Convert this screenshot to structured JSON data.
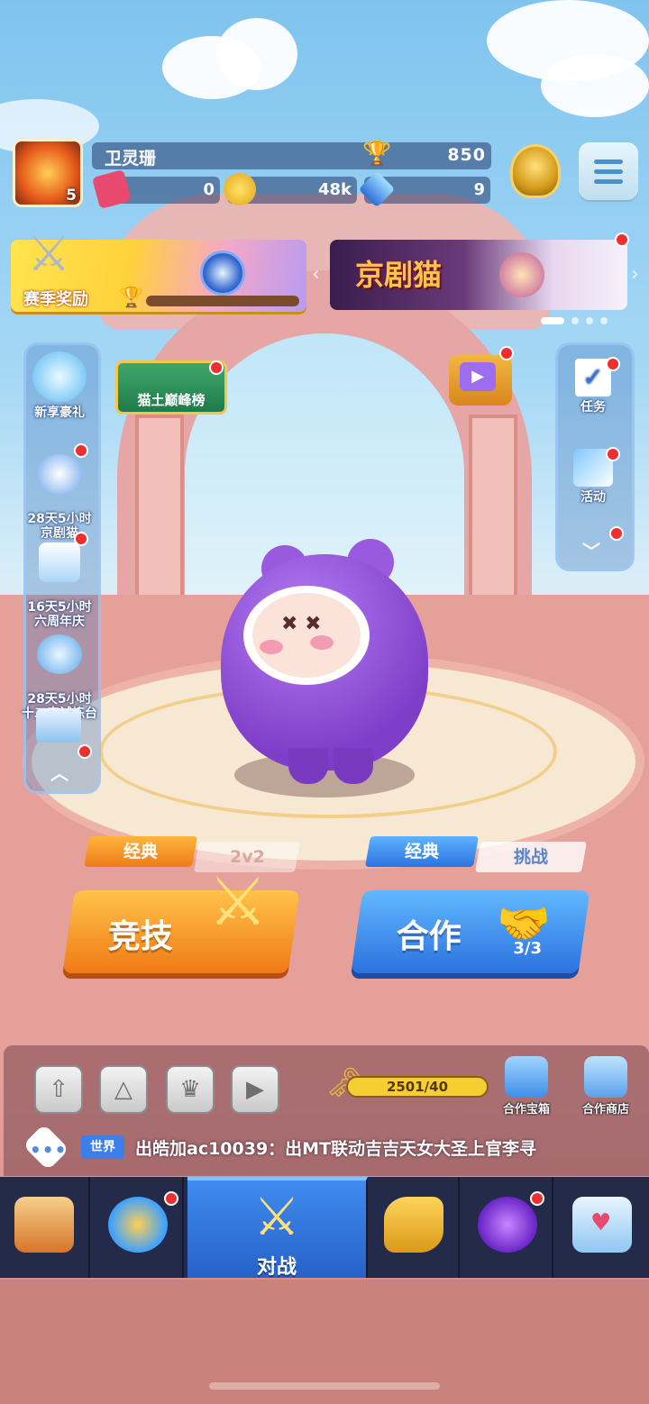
{
  "player": {
    "name": "卫灵珊",
    "level": "5",
    "trophies": "850",
    "currency_tickets": "0",
    "currency_coins": "48k",
    "currency_gems": "9"
  },
  "banners": {
    "season_reward": "赛季奖励",
    "event_title": "京剧猫"
  },
  "left_sidebar": [
    {
      "label": "新享豪礼",
      "icon": "lotus-gift-icon"
    },
    {
      "label": "28天5小时\n京剧猫",
      "icon": "cat-mask-icon"
    },
    {
      "label": "16天5小时\n六周年庆",
      "icon": "birthday-cake-icon"
    },
    {
      "label": "28天5小时\n十二宗试炼台",
      "icon": "star-shield-icon"
    }
  ],
  "leaderboard_label": "猫土巅峰榜",
  "right_sidebar": [
    {
      "label": "任务",
      "icon": "checklist-icon"
    },
    {
      "label": "活动",
      "icon": "party-popper-icon"
    }
  ],
  "modes": {
    "arena_tag": "经典",
    "arena_count": "2v2",
    "arena_label": "竞技",
    "coop_tag": "经典",
    "coop_sub": "挑战",
    "coop_label": "合作",
    "coop_count": "3/3"
  },
  "keys": {
    "progress": "2501/40"
  },
  "shop": {
    "coop_chest": "合作宝箱",
    "coop_shop": "合作商店"
  },
  "chat": {
    "channel": "世界",
    "message": "出皓加ac10039：出MT联动吉吉天女大圣上官李寻"
  },
  "nav": {
    "battle_label": "对战",
    "items": [
      "shop-icon",
      "gacha-icon",
      "battle-icon",
      "whistle-icon",
      "planet-icon",
      "social-icon"
    ]
  },
  "colors": {
    "arena_orange": "#f59a1e",
    "coop_blue": "#2f86e8",
    "nav_active": "#2f74d8",
    "notification_red": "#ee2f2f"
  }
}
